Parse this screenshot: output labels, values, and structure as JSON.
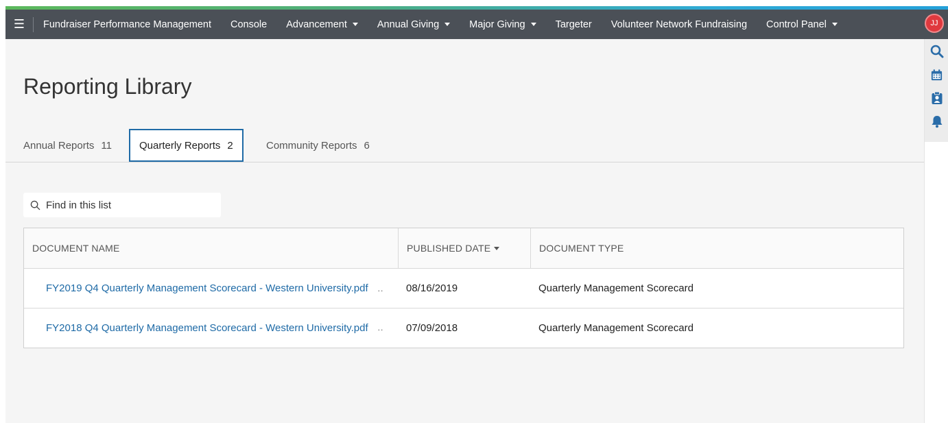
{
  "navbar": {
    "items": [
      {
        "label": "Fundraiser Performance Management",
        "dropdown": false
      },
      {
        "label": "Console",
        "dropdown": false
      },
      {
        "label": "Advancement",
        "dropdown": true
      },
      {
        "label": "Annual Giving",
        "dropdown": true
      },
      {
        "label": "Major Giving",
        "dropdown": true
      },
      {
        "label": "Targeter",
        "dropdown": false
      },
      {
        "label": "Volunteer Network Fundraising",
        "dropdown": false
      },
      {
        "label": "Control Panel",
        "dropdown": true
      }
    ],
    "avatar_initials": "JJ"
  },
  "page": {
    "title": "Reporting Library"
  },
  "tabs": [
    {
      "label": "Annual Reports",
      "count": "11",
      "active": false
    },
    {
      "label": "Quarterly Reports",
      "count": "2",
      "active": true
    },
    {
      "label": "Community Reports",
      "count": "6",
      "active": false
    }
  ],
  "search": {
    "placeholder": "Find in this list"
  },
  "table": {
    "columns": [
      "DOCUMENT NAME",
      "PUBLISHED DATE",
      "DOCUMENT TYPE"
    ],
    "sorted_column": "PUBLISHED DATE",
    "rows": [
      {
        "name": "FY2019 Q4 Quarterly Management Scorecard - Western University.pdf",
        "date": "08/16/2019",
        "type": "Quarterly Management Scorecard"
      },
      {
        "name": "FY2018 Q4 Quarterly Management Scorecard - Western University.pdf",
        "date": "07/09/2018",
        "type": "Quarterly Management Scorecard"
      }
    ],
    "truncation_marker": ".."
  },
  "right_toolbar": {
    "icons": [
      "search-icon",
      "calendar-icon",
      "clipboard-user-icon",
      "bell-icon"
    ]
  },
  "colors": {
    "navbar_bg": "#4b5057",
    "link": "#1e6aa6",
    "active_tab_border": "#1e6aa6",
    "avatar_bg": "#e0393e",
    "accent_gradient_start": "#5cb85c",
    "accent_gradient_end": "#24a0d8",
    "icon_blue": "#2a6ca8"
  }
}
